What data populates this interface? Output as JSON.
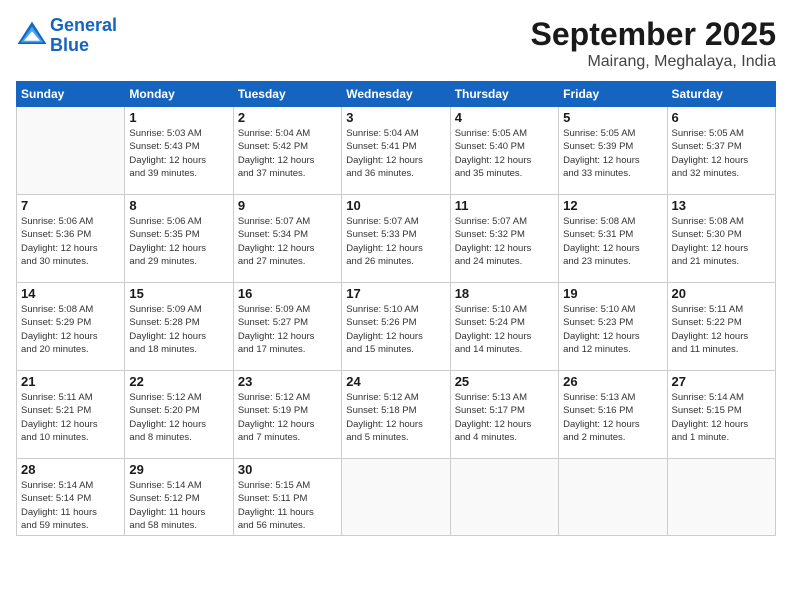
{
  "logo": {
    "line1": "General",
    "line2": "Blue"
  },
  "title": "September 2025",
  "subtitle": "Mairang, Meghalaya, India",
  "weekdays": [
    "Sunday",
    "Monday",
    "Tuesday",
    "Wednesday",
    "Thursday",
    "Friday",
    "Saturday"
  ],
  "weeks": [
    [
      {
        "day": "",
        "info": ""
      },
      {
        "day": "1",
        "info": "Sunrise: 5:03 AM\nSunset: 5:43 PM\nDaylight: 12 hours\nand 39 minutes."
      },
      {
        "day": "2",
        "info": "Sunrise: 5:04 AM\nSunset: 5:42 PM\nDaylight: 12 hours\nand 37 minutes."
      },
      {
        "day": "3",
        "info": "Sunrise: 5:04 AM\nSunset: 5:41 PM\nDaylight: 12 hours\nand 36 minutes."
      },
      {
        "day": "4",
        "info": "Sunrise: 5:05 AM\nSunset: 5:40 PM\nDaylight: 12 hours\nand 35 minutes."
      },
      {
        "day": "5",
        "info": "Sunrise: 5:05 AM\nSunset: 5:39 PM\nDaylight: 12 hours\nand 33 minutes."
      },
      {
        "day": "6",
        "info": "Sunrise: 5:05 AM\nSunset: 5:37 PM\nDaylight: 12 hours\nand 32 minutes."
      }
    ],
    [
      {
        "day": "7",
        "info": "Sunrise: 5:06 AM\nSunset: 5:36 PM\nDaylight: 12 hours\nand 30 minutes."
      },
      {
        "day": "8",
        "info": "Sunrise: 5:06 AM\nSunset: 5:35 PM\nDaylight: 12 hours\nand 29 minutes."
      },
      {
        "day": "9",
        "info": "Sunrise: 5:07 AM\nSunset: 5:34 PM\nDaylight: 12 hours\nand 27 minutes."
      },
      {
        "day": "10",
        "info": "Sunrise: 5:07 AM\nSunset: 5:33 PM\nDaylight: 12 hours\nand 26 minutes."
      },
      {
        "day": "11",
        "info": "Sunrise: 5:07 AM\nSunset: 5:32 PM\nDaylight: 12 hours\nand 24 minutes."
      },
      {
        "day": "12",
        "info": "Sunrise: 5:08 AM\nSunset: 5:31 PM\nDaylight: 12 hours\nand 23 minutes."
      },
      {
        "day": "13",
        "info": "Sunrise: 5:08 AM\nSunset: 5:30 PM\nDaylight: 12 hours\nand 21 minutes."
      }
    ],
    [
      {
        "day": "14",
        "info": "Sunrise: 5:08 AM\nSunset: 5:29 PM\nDaylight: 12 hours\nand 20 minutes."
      },
      {
        "day": "15",
        "info": "Sunrise: 5:09 AM\nSunset: 5:28 PM\nDaylight: 12 hours\nand 18 minutes."
      },
      {
        "day": "16",
        "info": "Sunrise: 5:09 AM\nSunset: 5:27 PM\nDaylight: 12 hours\nand 17 minutes."
      },
      {
        "day": "17",
        "info": "Sunrise: 5:10 AM\nSunset: 5:26 PM\nDaylight: 12 hours\nand 15 minutes."
      },
      {
        "day": "18",
        "info": "Sunrise: 5:10 AM\nSunset: 5:24 PM\nDaylight: 12 hours\nand 14 minutes."
      },
      {
        "day": "19",
        "info": "Sunrise: 5:10 AM\nSunset: 5:23 PM\nDaylight: 12 hours\nand 12 minutes."
      },
      {
        "day": "20",
        "info": "Sunrise: 5:11 AM\nSunset: 5:22 PM\nDaylight: 12 hours\nand 11 minutes."
      }
    ],
    [
      {
        "day": "21",
        "info": "Sunrise: 5:11 AM\nSunset: 5:21 PM\nDaylight: 12 hours\nand 10 minutes."
      },
      {
        "day": "22",
        "info": "Sunrise: 5:12 AM\nSunset: 5:20 PM\nDaylight: 12 hours\nand 8 minutes."
      },
      {
        "day": "23",
        "info": "Sunrise: 5:12 AM\nSunset: 5:19 PM\nDaylight: 12 hours\nand 7 minutes."
      },
      {
        "day": "24",
        "info": "Sunrise: 5:12 AM\nSunset: 5:18 PM\nDaylight: 12 hours\nand 5 minutes."
      },
      {
        "day": "25",
        "info": "Sunrise: 5:13 AM\nSunset: 5:17 PM\nDaylight: 12 hours\nand 4 minutes."
      },
      {
        "day": "26",
        "info": "Sunrise: 5:13 AM\nSunset: 5:16 PM\nDaylight: 12 hours\nand 2 minutes."
      },
      {
        "day": "27",
        "info": "Sunrise: 5:14 AM\nSunset: 5:15 PM\nDaylight: 12 hours\nand 1 minute."
      }
    ],
    [
      {
        "day": "28",
        "info": "Sunrise: 5:14 AM\nSunset: 5:14 PM\nDaylight: 11 hours\nand 59 minutes."
      },
      {
        "day": "29",
        "info": "Sunrise: 5:14 AM\nSunset: 5:12 PM\nDaylight: 11 hours\nand 58 minutes."
      },
      {
        "day": "30",
        "info": "Sunrise: 5:15 AM\nSunset: 5:11 PM\nDaylight: 11 hours\nand 56 minutes."
      },
      {
        "day": "",
        "info": ""
      },
      {
        "day": "",
        "info": ""
      },
      {
        "day": "",
        "info": ""
      },
      {
        "day": "",
        "info": ""
      }
    ]
  ]
}
